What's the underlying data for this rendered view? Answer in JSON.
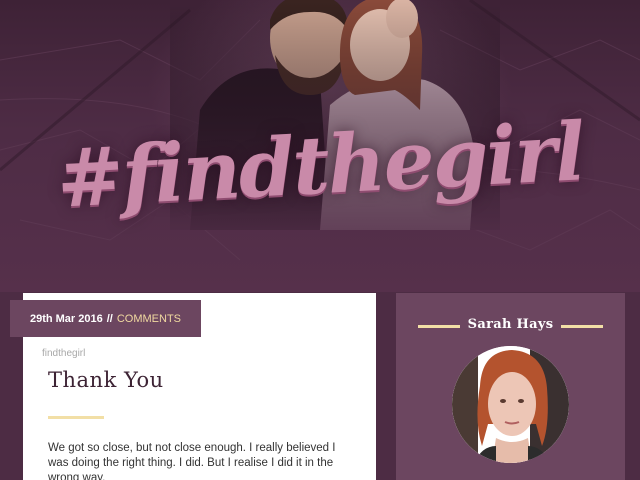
{
  "hero": {
    "title": "#findthegirl"
  },
  "post": {
    "date": "29th Mar 2016",
    "separator": "//",
    "comments_label": "COMMENTS",
    "category": "findthegirl",
    "title": "Thank You",
    "excerpt": "We got so close, but not close enough. I really believed I was doing the right thing. I did. But I realise I did it in the wrong way."
  },
  "sidebar": {
    "author_name": "Sarah Hays"
  },
  "colors": {
    "background": "#4d2c44",
    "panel": "#6c4660",
    "accent": "#f2dfa6",
    "title_script": "#c98aa9",
    "post_title": "#3d2334"
  }
}
